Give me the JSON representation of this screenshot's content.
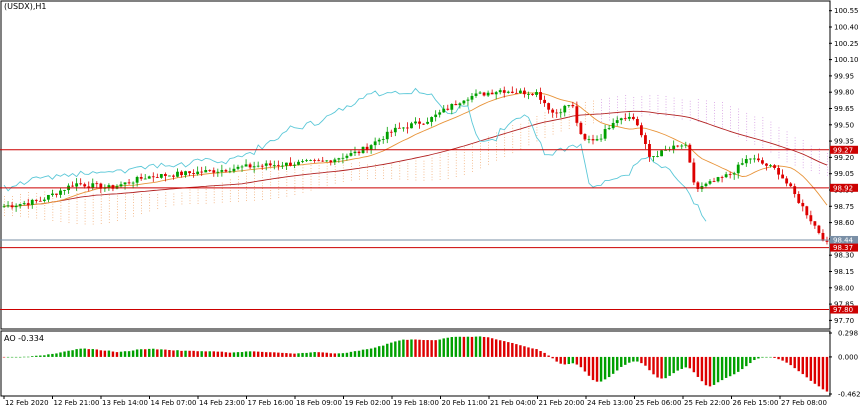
{
  "chart_data": {
    "type": "candlestick",
    "symbol_label": "(USDX),H1",
    "price_ylim": [
      97.63,
      100.63
    ],
    "price_ticks": [
      "100.55",
      "100.40",
      "100.25",
      "100.10",
      "99.95",
      "99.80",
      "99.65",
      "99.50",
      "99.35",
      "99.20",
      "99.05",
      "98.90",
      "98.75",
      "98.60",
      "98.45",
      "98.30",
      "98.15",
      "98.00",
      "97.85",
      "97.70"
    ],
    "x_labels": [
      "12 Feb 2020",
      "12 Feb 21:00",
      "13 Feb 14:00",
      "14 Feb 07:00",
      "14 Feb 23:00",
      "17 Feb 16:00",
      "18 Feb 09:00",
      "19 Feb 02:00",
      "19 Feb 18:00",
      "20 Feb 11:00",
      "21 Feb 04:00",
      "21 Feb 20:00",
      "24 Feb 13:00",
      "25 Feb 06:00",
      "25 Feb 22:00",
      "26 Feb 15:00",
      "27 Feb 08:00"
    ],
    "bars": 205,
    "close_path": [
      [
        0,
        98.75
      ],
      [
        10,
        98.8
      ],
      [
        20,
        98.96
      ],
      [
        30,
        98.92
      ],
      [
        40,
        99.02
      ],
      [
        50,
        99.05
      ],
      [
        60,
        99.08
      ],
      [
        70,
        99.12
      ],
      [
        80,
        99.14
      ],
      [
        90,
        99.16
      ],
      [
        100,
        99.25
      ],
      [
        110,
        99.45
      ],
      [
        120,
        99.55
      ],
      [
        130,
        99.75
      ],
      [
        140,
        99.82
      ],
      [
        145,
        99.8
      ],
      [
        150,
        99.8
      ],
      [
        155,
        99.6
      ],
      [
        160,
        99.7
      ],
      [
        163,
        99.35
      ],
      [
        168,
        99.38
      ],
      [
        172,
        99.55
      ],
      [
        175,
        99.58
      ],
      [
        178,
        99.55
      ],
      [
        182,
        99.2
      ],
      [
        188,
        99.28
      ],
      [
        192,
        99.32
      ],
      [
        195,
        98.9
      ],
      [
        205,
        99.05
      ],
      [
        210,
        99.2
      ],
      [
        218,
        99.08
      ],
      [
        222,
        98.9
      ],
      [
        228,
        98.6
      ],
      [
        232,
        98.4
      ]
    ],
    "overlays": [
      {
        "name": "moving-average-slow",
        "color": "#b22222"
      },
      {
        "name": "moving-average-fast",
        "color": "#e8943a"
      },
      {
        "name": "chikou-span",
        "color": "#5cc8d8"
      },
      {
        "name": "kumo-cloud-bull",
        "color": "#f0a060"
      },
      {
        "name": "kumo-cloud-bear",
        "color": "#cc88dd"
      }
    ],
    "levels": [
      {
        "value": 99.27,
        "label": "99.27",
        "color": "#cc0000"
      },
      {
        "value": 98.92,
        "label": "98.92",
        "color": "#cc0000"
      },
      {
        "value": 98.44,
        "label": "98.44",
        "color": "#7a8fa6"
      },
      {
        "value": 98.37,
        "label": "98.37",
        "color": "#cc0000"
      },
      {
        "value": 97.8,
        "label": "97.80",
        "color": "#cc0000"
      }
    ],
    "ao": {
      "label": "AO -0.334",
      "ylim": [
        -0.462,
        0.298
      ],
      "ticks": [
        "0.298",
        "0.000",
        "-0.462"
      ]
    },
    "colors": {
      "bull": "#00a000",
      "bear": "#dd0000",
      "axis": "#000000"
    }
  }
}
